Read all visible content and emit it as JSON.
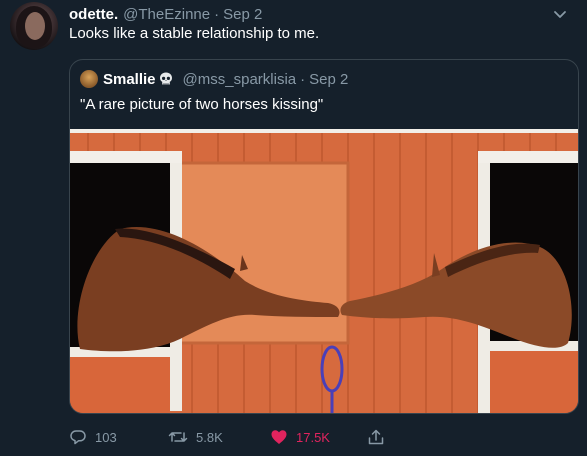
{
  "tweet": {
    "author_name": "odette.",
    "author_handle": "@TheEzinne",
    "separator": "·",
    "date": "Sep 2",
    "text": "Looks like a stable relationship to me."
  },
  "quoted": {
    "author_name": "Smallie",
    "author_emoji": "skull-emoji",
    "author_handle": "@mss_sparklisia",
    "separator": "·",
    "date": "Sep 2",
    "text": "\"A rare picture of two horses kissing\""
  },
  "actions": {
    "replies": "103",
    "retweets": "5.8K",
    "likes": "17.5K"
  },
  "colors": {
    "background": "#15202b",
    "secondary_text": "#8899a6",
    "like": "#e0245e",
    "border": "#38444d"
  }
}
